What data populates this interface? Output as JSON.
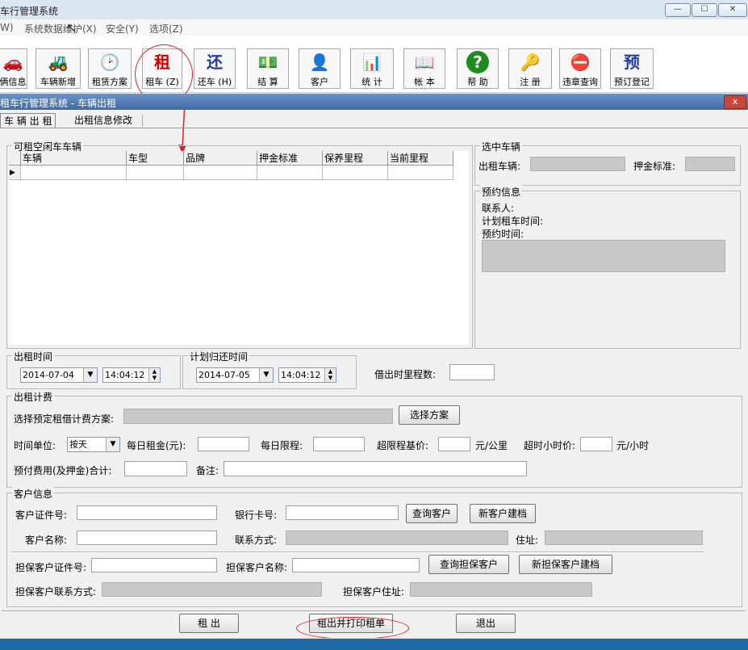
{
  "window": {
    "title": "车行管理系统"
  },
  "menu": [
    "W)",
    "系统数据维护(X)",
    "安全(Y)",
    "选项(Z)"
  ],
  "toolbar": [
    {
      "label": "俩信息",
      "icon": "car-red-icon",
      "glyph": "🚗"
    },
    {
      "label": "车辆新增",
      "icon": "truck-green-icon",
      "glyph": "🚜"
    },
    {
      "label": "租赁方案",
      "icon": "clock-icon",
      "glyph": "🕑"
    },
    {
      "label": "租车 (Z)",
      "icon": "rent-char-icon",
      "glyph": "租"
    },
    {
      "label": "还车 (H)",
      "icon": "return-char-icon",
      "glyph": "还"
    },
    {
      "label": "结 算",
      "icon": "money-icon",
      "glyph": "💵"
    },
    {
      "label": "客户",
      "icon": "customer-icon",
      "glyph": "👤"
    },
    {
      "label": "统 计",
      "icon": "bar-chart-icon",
      "glyph": "📊"
    },
    {
      "label": "帐 本",
      "icon": "book-icon",
      "glyph": "📖"
    },
    {
      "label": "帮 助",
      "icon": "help-icon",
      "glyph": "?"
    },
    {
      "label": "注 册",
      "icon": "keys-icon",
      "glyph": "🔑"
    },
    {
      "label": "违章查询",
      "icon": "no-truck-icon",
      "glyph": "⛔"
    },
    {
      "label": "预订登记",
      "icon": "reserve-char-icon",
      "glyph": "预"
    }
  ],
  "child_window": {
    "title": "租车行管理系统 - 车辆出租",
    "close": "x"
  },
  "tabs": [
    "车 辆 出 租",
    "出租信息修改"
  ],
  "available": {
    "title": "可租空闲车车辆",
    "columns": [
      "车辆",
      "车型",
      "品牌",
      "押金标准",
      "保养里程",
      "当前里程"
    ],
    "row_marker": "▶"
  },
  "selected": {
    "title": "选中车辆",
    "car_label": "出租车辆:",
    "deposit_label": "押金标准:"
  },
  "reservation": {
    "title": "预约信息",
    "contact": "联系人:",
    "plan_time": "计划租车时间:",
    "reserve_time": "预约时间:"
  },
  "rent_time": {
    "title": "出租时间",
    "date": "2014-07-04",
    "time": "14:04:12"
  },
  "return_time": {
    "title": "计划归还时间",
    "date": "2014-07-05",
    "time": "14:04:12"
  },
  "mileage": {
    "label": "借出时里程数:"
  },
  "billing": {
    "title": "出租计费",
    "plan_label": "选择预定租借计费方案:",
    "plan_button": "选择方案",
    "unit_label": "时间单位:",
    "unit_value": "按天",
    "daily_rent_label": "每日租金(元):",
    "daily_limit_label": "每日限程:",
    "over_base_label": "超限程基价:",
    "over_base_unit": "元/公里",
    "overtime_label": "超时小时价:",
    "overtime_unit": "元/小时",
    "prepay_label": "预付费用(及押金)合计:",
    "remark_label": "备注:"
  },
  "customer": {
    "title": "客户信息",
    "id_label": "客户证件号:",
    "bank_label": "银行卡号:",
    "query_button": "查询客户",
    "new_button": "新客户建档",
    "name_label": "客户名称:",
    "contact_label": "联系方式:",
    "address_label": "住址:",
    "g_id_label": "担保客户证件号:",
    "g_name_label": "担保客户名称:",
    "g_query_button": "查询担保客户",
    "g_new_button": "新担保客户建档",
    "g_contact_label": "担保客户联系方式:",
    "g_address_label": "担保客户住址:"
  },
  "actions": {
    "rent": "租 出",
    "rent_print": "租出并打印租单",
    "exit": "退出"
  },
  "colors": {
    "annotation": "#e02020",
    "readonly": "#c8c8c8"
  }
}
